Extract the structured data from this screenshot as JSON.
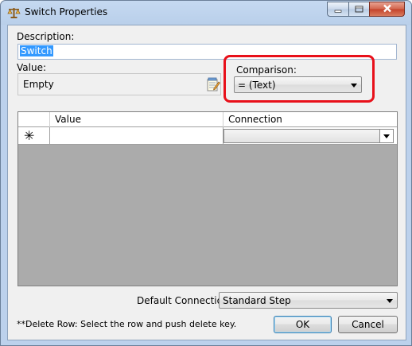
{
  "window": {
    "title": "Switch Properties"
  },
  "description": {
    "label": "Description:",
    "value": "Switch"
  },
  "value": {
    "label": "Value:",
    "text": "Empty"
  },
  "comparison": {
    "label": "Comparison:",
    "selected": "= (Text)"
  },
  "grid": {
    "columns": [
      "Value",
      "Connection"
    ],
    "new_row_marker": "✳"
  },
  "default_connection": {
    "label": "Default Connection:",
    "selected": "Standard Step"
  },
  "hint": "**Delete Row: Select the row and push delete key.",
  "buttons": {
    "ok": "OK",
    "cancel": "Cancel"
  },
  "icons": {
    "app": "switch-scale-icon",
    "edit": "edit-notepad-icon",
    "minimize": "minimize-icon",
    "maximize": "maximize-icon",
    "close": "close-icon",
    "dropdown": "chevron-down-icon"
  },
  "colors": {
    "highlight": "#e8101a",
    "selection": "#3399ff",
    "grid_background": "#ababab"
  }
}
